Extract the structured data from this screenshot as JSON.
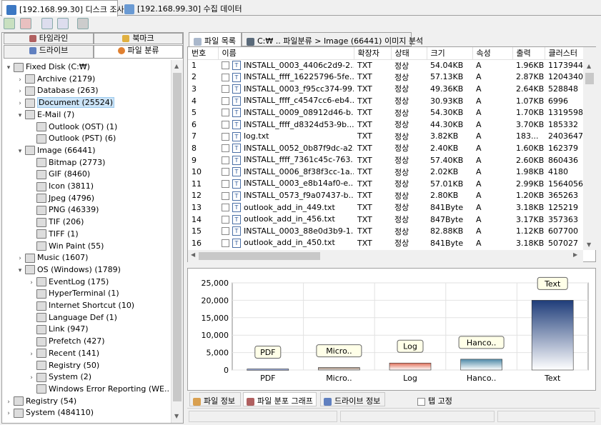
{
  "top_tabs": [
    {
      "label": "[192.168.99.30] 디스크 조사",
      "active": true
    },
    {
      "label": "[192.168.99.30] 수집 데이터",
      "active": false
    }
  ],
  "left_tabs": {
    "row1": [
      "타임라인",
      "북마크"
    ],
    "row2": [
      "드라이브",
      "파일 분류"
    ]
  },
  "tree": [
    {
      "level": 0,
      "tw": "▾",
      "label": "Fixed Disk (C:₩)",
      "icon": "disk-icon"
    },
    {
      "level": 1,
      "tw": "›",
      "label": "Archive (2179)",
      "icon": "folder-icon"
    },
    {
      "level": 1,
      "tw": "›",
      "label": "Database (263)",
      "icon": "database-icon"
    },
    {
      "level": 1,
      "tw": "›",
      "label": "Document (25524)",
      "icon": "document-icon",
      "selected": true
    },
    {
      "level": 1,
      "tw": "▾",
      "label": "E-Mail (7)",
      "icon": "email-icon"
    },
    {
      "level": 2,
      "tw": "",
      "label": "Outlook (OST) (1)",
      "icon": "outlook-icon"
    },
    {
      "level": 2,
      "tw": "",
      "label": "Outlook (PST) (6)",
      "icon": "outlook-icon"
    },
    {
      "level": 1,
      "tw": "▾",
      "label": "Image (66441)",
      "icon": "image-icon"
    },
    {
      "level": 2,
      "tw": "",
      "label": "Bitmap (2773)",
      "icon": "image-icon"
    },
    {
      "level": 2,
      "tw": "",
      "label": "GIF (8460)",
      "icon": "image-icon"
    },
    {
      "level": 2,
      "tw": "",
      "label": "Icon (3811)",
      "icon": "image-icon"
    },
    {
      "level": 2,
      "tw": "",
      "label": "Jpeg (4796)",
      "icon": "image-icon"
    },
    {
      "level": 2,
      "tw": "",
      "label": "PNG (46339)",
      "icon": "image-icon"
    },
    {
      "level": 2,
      "tw": "",
      "label": "TIF (206)",
      "icon": "image-icon"
    },
    {
      "level": 2,
      "tw": "",
      "label": "TIFF (1)",
      "icon": "image-icon"
    },
    {
      "level": 2,
      "tw": "",
      "label": "Win Paint (55)",
      "icon": "image-icon"
    },
    {
      "level": 1,
      "tw": "›",
      "label": "Music (1607)",
      "icon": "music-icon"
    },
    {
      "level": 1,
      "tw": "▾",
      "label": "OS (Windows) (1789)",
      "icon": "windows-icon"
    },
    {
      "level": 2,
      "tw": "›",
      "label": "EventLog (175)",
      "icon": "eventlog-icon"
    },
    {
      "level": 2,
      "tw": "",
      "label": "HyperTerminal (1)",
      "icon": "terminal-icon"
    },
    {
      "level": 2,
      "tw": "",
      "label": "Internet Shortcut (10)",
      "icon": "ie-icon"
    },
    {
      "level": 2,
      "tw": "",
      "label": "Language Def (1)",
      "icon": "file-icon"
    },
    {
      "level": 2,
      "tw": "",
      "label": "Link (947)",
      "icon": "link-icon"
    },
    {
      "level": 2,
      "tw": "",
      "label": "Prefetch (427)",
      "icon": "gear-icon"
    },
    {
      "level": 2,
      "tw": "›",
      "label": "Recent (141)",
      "icon": "gear-icon"
    },
    {
      "level": 2,
      "tw": "",
      "label": "Registry (50)",
      "icon": "gear-icon"
    },
    {
      "level": 2,
      "tw": "›",
      "label": "System (2)",
      "icon": "gear-icon"
    },
    {
      "level": 2,
      "tw": "",
      "label": "Windows Error Reporting (WE...",
      "icon": "file-icon"
    },
    {
      "level": 0,
      "tw": "›",
      "label": "Registry (54)",
      "icon": "registry-icon"
    },
    {
      "level": 0,
      "tw": "›",
      "label": "System (484110)",
      "icon": "system-icon"
    }
  ],
  "right_tabs": [
    "파일 목록",
    "C:₩ .. 파일분류 > Image (66441) 이미지 분석"
  ],
  "table": {
    "headers": [
      "번호",
      "이름",
      "확장자",
      "상태",
      "크기",
      "속성",
      "클러스터"
    ],
    "rows": [
      [
        "1",
        "INSTALL_0003_4406c2d9-2...",
        "TXT",
        "정상",
        "54.04KB",
        "A",
        "1.96KB",
        "1173944"
      ],
      [
        "2",
        "INSTALL_ffff_16225796-5fe...",
        "TXT",
        "정상",
        "57.13KB",
        "A",
        "2.87KB",
        "1204340"
      ],
      [
        "3",
        "INSTALL_0003_f95cc374-99...",
        "TXT",
        "정상",
        "49.36KB",
        "A",
        "2.64KB",
        "528848"
      ],
      [
        "4",
        "INSTALL_ffff_c4547cc6-eb4...",
        "TXT",
        "정상",
        "30.93KB",
        "A",
        "1.07KB",
        "6996"
      ],
      [
        "5",
        "INSTALL_0009_08912d46-b...",
        "TXT",
        "정상",
        "54.30KB",
        "A",
        "1.70KB",
        "1319598"
      ],
      [
        "6",
        "INSTALL_ffff_d8324d53-9b...",
        "TXT",
        "정상",
        "44.30KB",
        "A",
        "3.70KB",
        "185332"
      ],
      [
        "7",
        "log.txt",
        "TXT",
        "정상",
        "3.82KB",
        "A",
        "183...",
        "2403647"
      ],
      [
        "8",
        "INSTALL_0052_0b87f9dc-a2...",
        "TXT",
        "정상",
        "2.40KB",
        "A",
        "1.60KB",
        "162379"
      ],
      [
        "9",
        "INSTALL_ffff_7361c45c-763...",
        "TXT",
        "정상",
        "57.40KB",
        "A",
        "2.60KB",
        "860436"
      ],
      [
        "10",
        "INSTALL_0006_8f38f3cc-1a...",
        "TXT",
        "정상",
        "2.02KB",
        "A",
        "1.98KB",
        "4180"
      ],
      [
        "11",
        "INSTALL_0003_e8b14af0-e...",
        "TXT",
        "정상",
        "57.01KB",
        "A",
        "2.99KB",
        "1564056"
      ],
      [
        "12",
        "INSTALL_0573_f9a07437-b...",
        "TXT",
        "정상",
        "2.80KB",
        "A",
        "1.20KB",
        "365263"
      ],
      [
        "13",
        "outlook_add_in_449.txt",
        "TXT",
        "정상",
        "841Byte",
        "A",
        "3.18KB",
        "125219"
      ],
      [
        "14",
        "outlook_add_in_456.txt",
        "TXT",
        "정상",
        "847Byte",
        "A",
        "3.17KB",
        "357363"
      ],
      [
        "15",
        "INSTALL_0003_88e0d3b9-1...",
        "TXT",
        "정상",
        "82.88KB",
        "A",
        "1.12KB",
        "607700"
      ],
      [
        "16",
        "outlook_add_in_450.txt",
        "TXT",
        "정상",
        "841Byte",
        "A",
        "3.18KB",
        "507027"
      ]
    ]
  },
  "chart_data": {
    "type": "bar",
    "categories": [
      "PDF",
      "Micro..",
      "Log",
      "Hanco..",
      "Text"
    ],
    "values": [
      300,
      700,
      2000,
      3100,
      20000
    ],
    "ylim": [
      0,
      25000
    ],
    "yticks": [
      "0",
      "5,000",
      "10,000",
      "15,000",
      "20,000",
      "25,000"
    ],
    "grid": true,
    "colors": [
      "#3b5bb0",
      "#8a6b55",
      "#e0705a",
      "#4f8aa8",
      "#1f3d7a"
    ]
  },
  "bottom_tabs": [
    "파일 정보",
    "파일 분포 그래프",
    "드라이브 정보"
  ],
  "pin_tab_label": "탭 고정"
}
